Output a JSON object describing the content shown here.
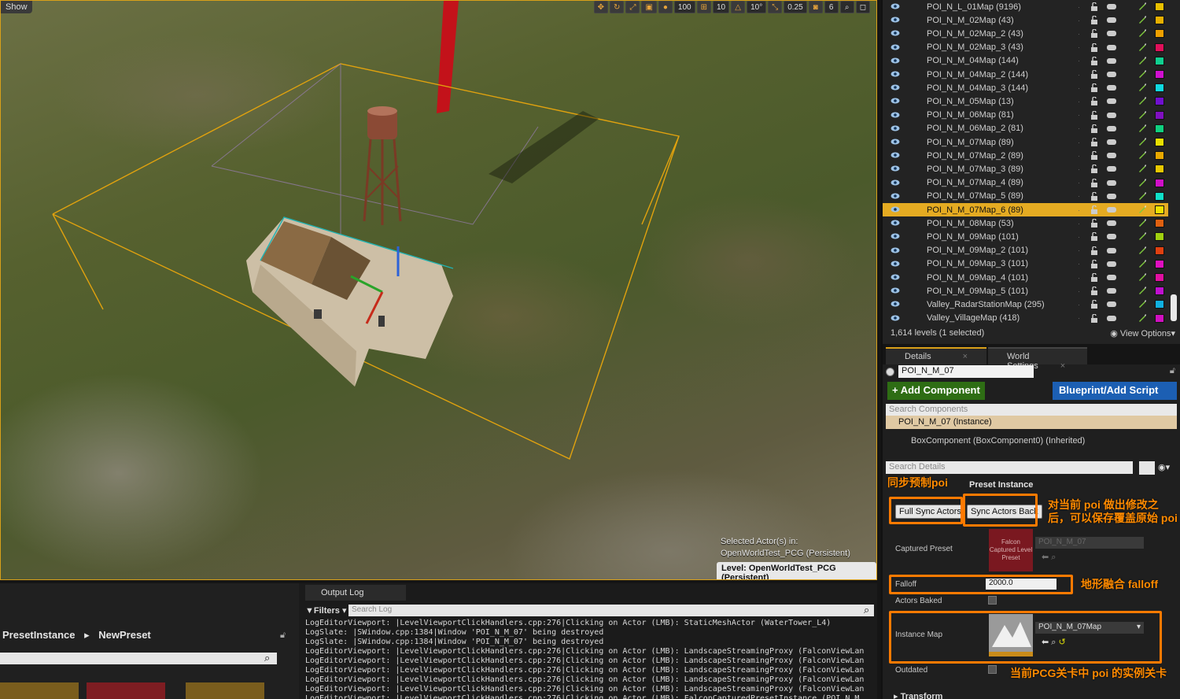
{
  "viewport": {
    "show_label": "Show",
    "toolbar": [
      "100",
      "10",
      "10°",
      "0.25",
      "6"
    ],
    "selected_actor_line1": "Selected Actor(s) in:",
    "selected_actor_line2": "OpenWorldTest_PCG (Persistent)",
    "level_prefix": "Level:",
    "level_name": "OpenWorldTest_PCG (Persistent)"
  },
  "outliner": {
    "levels": [
      {
        "name": "POI_N_L_01Map (9196)",
        "color": "#e8c000"
      },
      {
        "name": "POI_N_M_02Map (43)",
        "color": "#e8b000"
      },
      {
        "name": "POI_N_M_02Map_2 (43)",
        "color": "#f0a000"
      },
      {
        "name": "POI_N_M_02Map_3 (43)",
        "color": "#e0105a"
      },
      {
        "name": "POI_N_M_04Map (144)",
        "color": "#10d090"
      },
      {
        "name": "POI_N_M_04Map_2 (144)",
        "color": "#d010d0"
      },
      {
        "name": "POI_N_M_04Map_3 (144)",
        "color": "#10d8e0"
      },
      {
        "name": "POI_N_M_05Map (13)",
        "color": "#7010d0"
      },
      {
        "name": "POI_N_M_06Map (81)",
        "color": "#8010c0"
      },
      {
        "name": "POI_N_M_06Map_2 (81)",
        "color": "#10d080"
      },
      {
        "name": "POI_N_M_07Map (89)",
        "color": "#e8e000"
      },
      {
        "name": "POI_N_M_07Map_2 (89)",
        "color": "#e8a800"
      },
      {
        "name": "POI_N_M_07Map_3 (89)",
        "color": "#e8c800"
      },
      {
        "name": "POI_N_M_07Map_4 (89)",
        "color": "#d010c8"
      },
      {
        "name": "POI_N_M_07Map_5 (89)",
        "color": "#10e0c8"
      },
      {
        "name": "POI_N_M_07Map_6 (89)",
        "color": "#f0e000",
        "selected": true
      },
      {
        "name": "POI_N_M_08Map (53)",
        "color": "#e06010"
      },
      {
        "name": "POI_N_M_09Map (101)",
        "color": "#a0d010"
      },
      {
        "name": "POI_N_M_09Map_2 (101)",
        "color": "#e04010"
      },
      {
        "name": "POI_N_M_09Map_3 (101)",
        "color": "#e010c0"
      },
      {
        "name": "POI_N_M_09Map_4 (101)",
        "color": "#e010a0"
      },
      {
        "name": "POI_N_M_09Map_5 (101)",
        "color": "#c010d0"
      },
      {
        "name": "Valley_RadarStationMap (295)",
        "color": "#10b0e0"
      },
      {
        "name": "Valley_VillageMap (418)",
        "color": "#d010c0"
      }
    ],
    "status": "1,614 levels (1 selected)",
    "view_options": "View Options"
  },
  "details": {
    "tab_details": "Details",
    "tab_world_settings": "World Settings",
    "actor_name": "POI_N_M_07",
    "add_component": "+ Add Component",
    "blueprint_script": "Blueprint/Add Script",
    "search_components": "Search Components",
    "instance_row": "POI_N_M_07 (Instance)",
    "box_component": "BoxComponent (BoxComponent0) (Inherited)",
    "search_details": "Search Details",
    "section_title": "Preset Instance",
    "full_sync": "Full Sync Actors",
    "sync_back": "Sync Actors Back",
    "captured_preset_label": "Captured Preset",
    "captured_preset_thumb": "Falcon Captured Level Preset",
    "captured_preset_value": "POI_N_M_07",
    "falloff_label": "Falloff",
    "falloff_value": "2000.0",
    "actors_baked_label": "Actors Baked",
    "instance_map_label": "Instance Map",
    "instance_map_value": "POI_N_M_07Map",
    "outdated_label": "Outdated",
    "transform_label": "Transform"
  },
  "annotations": {
    "sync_from_poi": "同步预制poi",
    "modify_note": "对当前 poi 做出修改之后，可以保存覆盖原始 poi",
    "terrain_falloff": "地形融合 falloff",
    "instance_note": "当前PCG关卡中 poi 的实例关卡"
  },
  "content_browser": {
    "path_root": "PresetInstance",
    "path_child": "NewPreset"
  },
  "output_log": {
    "tab": "Output Log",
    "filters": "Filters",
    "search_placeholder": "Search Log",
    "lines": [
      "LogEditorViewport: |LevelViewportClickHandlers.cpp:276|Clicking on Actor (LMB): StaticMeshActor (WaterTower_L4)",
      "LogSlate: |SWindow.cpp:1384|Window 'POI_N_M_07' being destroyed",
      "LogSlate: |SWindow.cpp:1384|Window 'POI_N_M_07' being destroyed",
      "LogEditorViewport: |LevelViewportClickHandlers.cpp:276|Clicking on Actor (LMB): LandscapeStreamingProxy (FalconViewLan",
      "LogEditorViewport: |LevelViewportClickHandlers.cpp:276|Clicking on Actor (LMB): LandscapeStreamingProxy (FalconViewLan",
      "LogEditorViewport: |LevelViewportClickHandlers.cpp:276|Clicking on Actor (LMB): LandscapeStreamingProxy (FalconViewLan",
      "LogEditorViewport: |LevelViewportClickHandlers.cpp:276|Clicking on Actor (LMB): LandscapeStreamingProxy (FalconViewLan",
      "LogEditorViewport: |LevelViewportClickHandlers.cpp:276|Clicking on Actor (LMB): LandscapeStreamingProxy (FalconViewLan",
      "LogEditorViewport: |LevelViewportClickHandlers.cpp:276|Clicking on Actor (LMB): FalconCapturedPresetInstance (POI_N_M_"
    ]
  }
}
